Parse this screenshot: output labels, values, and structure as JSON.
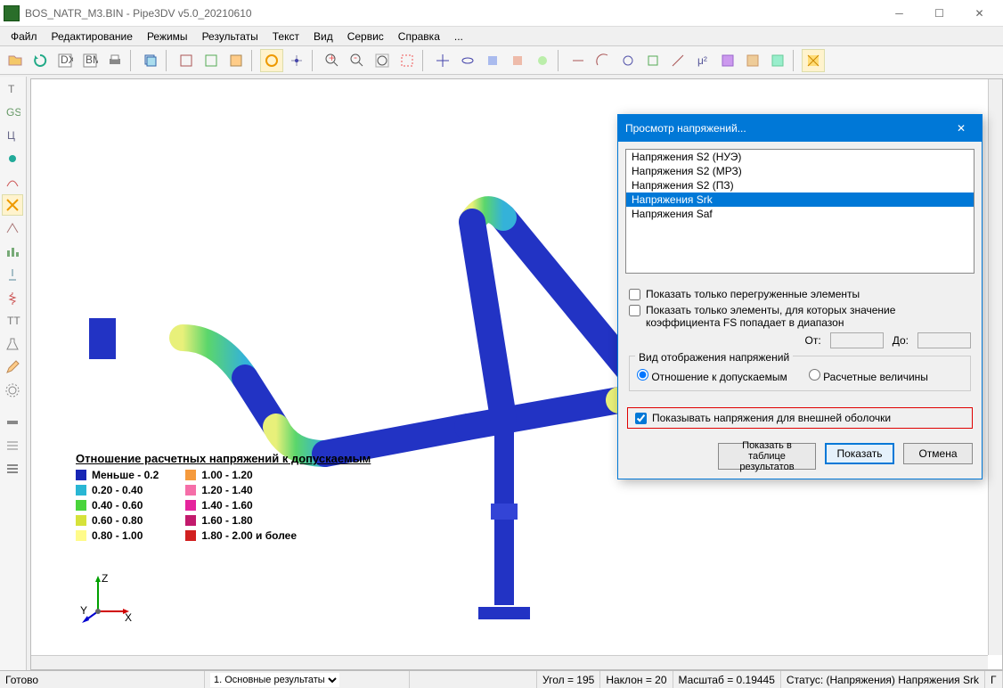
{
  "window": {
    "title": "BOS_NATR_M3.BIN - Pipe3DV v5.0_20210610"
  },
  "menu": [
    "Файл",
    "Редактирование",
    "Режимы",
    "Результаты",
    "Текст",
    "Вид",
    "Сервис",
    "Справка",
    "..."
  ],
  "legend": {
    "title": "Отношение расчетных напряжений к допускаемым",
    "left": [
      {
        "c": "#1726b5",
        "t": "Меньше - 0.2"
      },
      {
        "c": "#29b6d4",
        "t": "0.20 - 0.40"
      },
      {
        "c": "#49d43b",
        "t": "0.40 - 0.60"
      },
      {
        "c": "#d6e23a",
        "t": "0.60 - 0.80"
      },
      {
        "c": "#fffb8a",
        "t": "0.80 - 1.00"
      }
    ],
    "right": [
      {
        "c": "#f59a3d",
        "t": "1.00 - 1.20"
      },
      {
        "c": "#f56ea8",
        "t": "1.20 - 1.40"
      },
      {
        "c": "#e5249c",
        "t": "1.40 - 1.60"
      },
      {
        "c": "#c21a6c",
        "t": "1.60 - 1.80"
      },
      {
        "c": "#d12020",
        "t": "1.80 - 2.00 и более"
      }
    ]
  },
  "dialog": {
    "title": "Просмотр напряжений...",
    "items": [
      "Напряжения S2 (НУЭ)",
      "Напряжения S2 (МРЗ)",
      "Напряжения S2 (ПЗ)",
      "Напряжения Srk",
      "Напряжения Saf"
    ],
    "selected": 3,
    "check_overloaded": "Показать только перегруженные элементы",
    "check_fs": "Показать только элементы, для которых значение коэффициента FS попадает в диапазон",
    "from": "От:",
    "to": "До:",
    "group_title": "Вид отображения напряжений",
    "radio1": "Отношение к допускаемым",
    "radio2": "Расчетные величины",
    "check_outer": "Показывать напряжения для внешней оболочки",
    "btn_table": "Показать в таблице результатов",
    "btn_show": "Показать",
    "btn_cancel": "Отмена"
  },
  "status": {
    "ready": "Готово",
    "dropdown": "1.   Основные результаты",
    "angle": "Угол = 195",
    "tilt": "Наклон = 20",
    "scale": "Масштаб = 0.19445",
    "mode": "Статус: (Напряжения) Напряжения Srk",
    "g": "Г"
  }
}
